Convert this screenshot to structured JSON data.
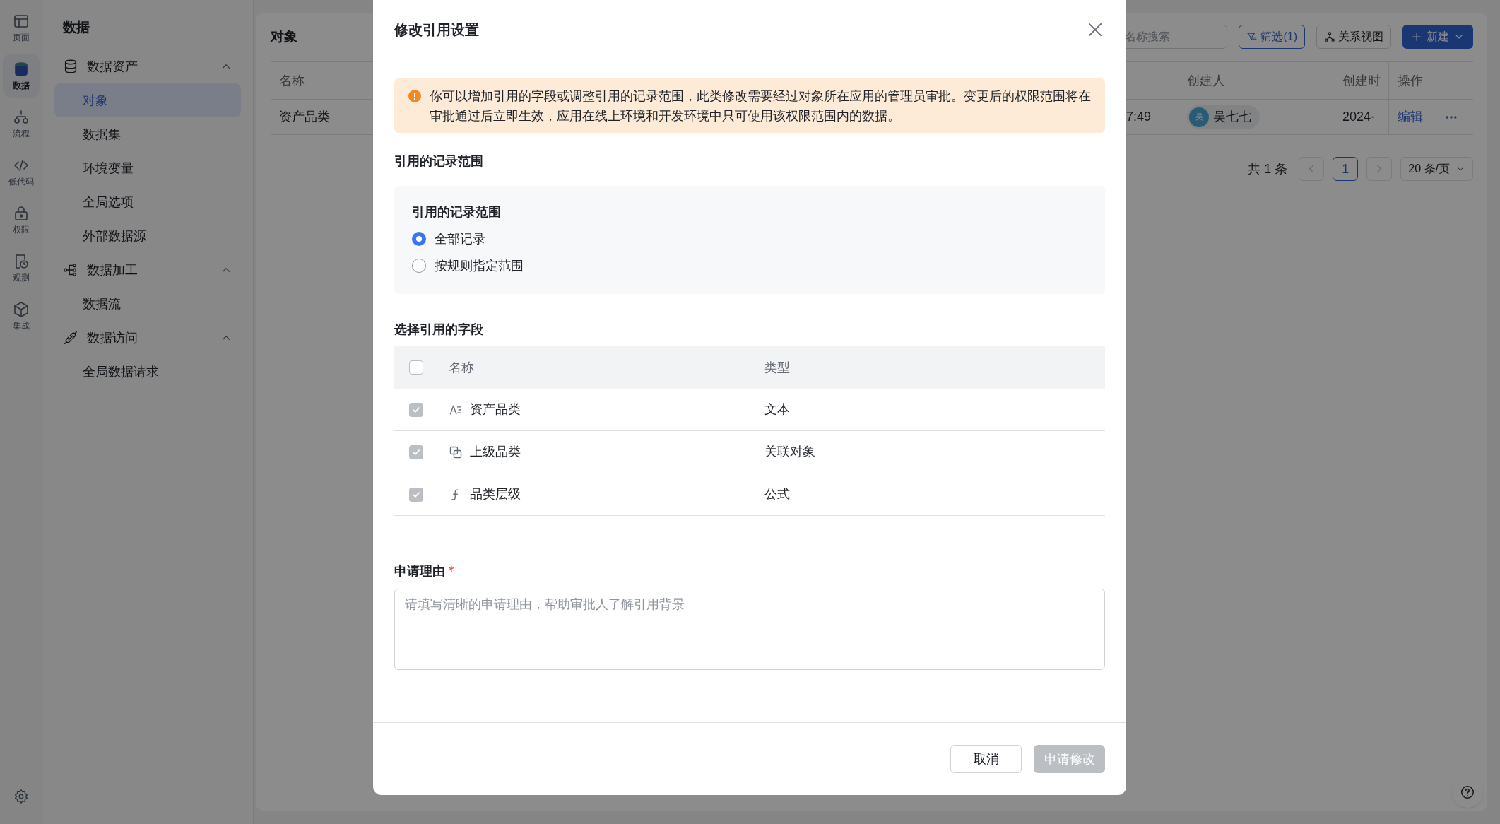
{
  "rail": {
    "items": [
      {
        "label": "页面",
        "kind": "page",
        "selected": false
      },
      {
        "label": "数据",
        "kind": "data",
        "selected": true
      },
      {
        "label": "流程",
        "kind": "flow",
        "selected": false
      },
      {
        "label": "低代码",
        "kind": "code",
        "selected": false
      },
      {
        "label": "权限",
        "kind": "lock",
        "selected": false
      },
      {
        "label": "观测",
        "kind": "observe",
        "selected": false
      },
      {
        "label": "集成",
        "kind": "integrate",
        "selected": false
      }
    ]
  },
  "sidebar": {
    "title": "数据",
    "groups": [
      {
        "label": "数据资产",
        "kind": "database",
        "expanded": true,
        "children": [
          {
            "label": "对象",
            "selected": true
          },
          {
            "label": "数据集",
            "selected": false
          },
          {
            "label": "环境变量",
            "selected": false
          },
          {
            "label": "全局选项",
            "selected": false
          },
          {
            "label": "外部数据源",
            "selected": false
          }
        ]
      },
      {
        "label": "数据加工",
        "kind": "process",
        "expanded": true,
        "children": [
          {
            "label": "数据流",
            "selected": false
          }
        ]
      },
      {
        "label": "数据访问",
        "kind": "access",
        "expanded": true,
        "children": [
          {
            "label": "全局数据请求",
            "selected": false
          }
        ]
      }
    ]
  },
  "main": {
    "title": "对象",
    "search": {
      "placeholder": "名称搜索"
    },
    "filter_button": "筛选(1)",
    "relation_button": "关系视图",
    "new_button": "新建",
    "table": {
      "columns": {
        "name": "名称",
        "creator": "创建人",
        "created_time": "创建时",
        "actions": "操作"
      },
      "rows": [
        {
          "name": "资产品类",
          "updated_time": "7:49",
          "avatar": "吴",
          "creator": "吴七七",
          "created_time": "2024-",
          "edit": "编辑"
        }
      ]
    },
    "pagination": {
      "total": "共 1 条",
      "pages": [
        {
          "label": "1",
          "selected": true
        }
      ],
      "page_size": "20 条/页"
    }
  },
  "modal": {
    "title": "修改引用设置",
    "notice": "你可以增加引用的字段或调整引用的记录范围，此类修改需要经过对象所在应用的管理员审批。变更后的权限范围将在审批通过后立即生效，应用在线上环境和开发环境中只可使用该权限范围内的数据。",
    "range_section": "引用的记录范围",
    "range": {
      "label": "引用的记录范围",
      "options": [
        {
          "label": "全部记录",
          "selected": true
        },
        {
          "label": "按规则指定范围",
          "selected": false
        }
      ]
    },
    "fields_section": "选择引用的字段",
    "fields": {
      "columns": {
        "name": "名称",
        "type": "类型"
      },
      "all_checked": false,
      "rows": [
        {
          "name": "资产品类",
          "type": "文本",
          "kind": "text",
          "checked": true,
          "disabled": true
        },
        {
          "name": "上级品类",
          "type": "关联对象",
          "kind": "relation",
          "checked": true,
          "disabled": true
        },
        {
          "name": "品类层级",
          "type": "公式",
          "kind": "formula",
          "checked": true,
          "disabled": true
        }
      ]
    },
    "reason": {
      "label": "申请理由",
      "required": true,
      "placeholder": "请填写清晰的申请理由，帮助审批人了解引用背景"
    },
    "cancel_button": "取消",
    "submit_button": {
      "label": "申请修改",
      "disabled": true
    }
  }
}
